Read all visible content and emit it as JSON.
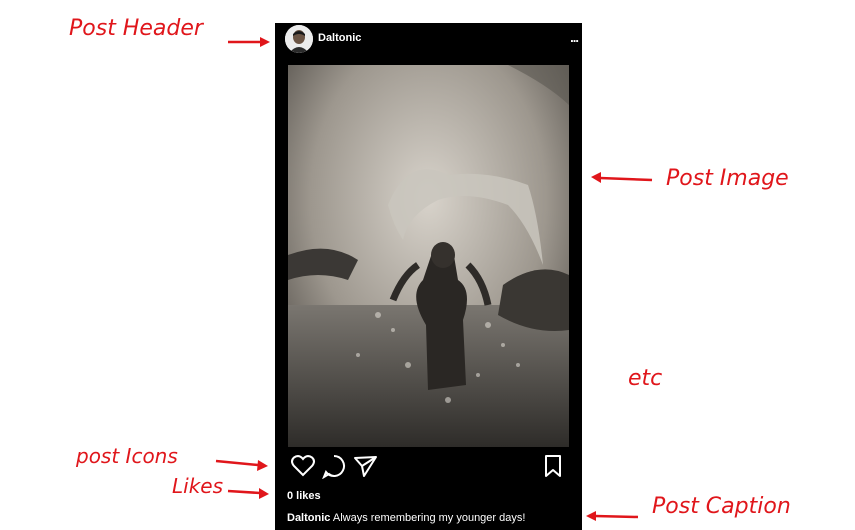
{
  "post": {
    "username": "Daltonic",
    "more_label": "...",
    "likes": "0 likes",
    "caption_user": "Daltonic",
    "caption_text": " Always remembering my younger days!"
  },
  "icons": {
    "like": "heart-icon",
    "comment": "comment-icon",
    "share": "send-icon",
    "save": "bookmark-icon"
  },
  "annotations": {
    "post_header": "Post Header",
    "post_image": "Post Image",
    "etc": "etc",
    "post_icons": "post Icons",
    "likes": "Likes",
    "post_caption": "Post Caption"
  },
  "colors": {
    "annotation": "#e0161b",
    "background": "#000000",
    "text": "#ffffff"
  }
}
